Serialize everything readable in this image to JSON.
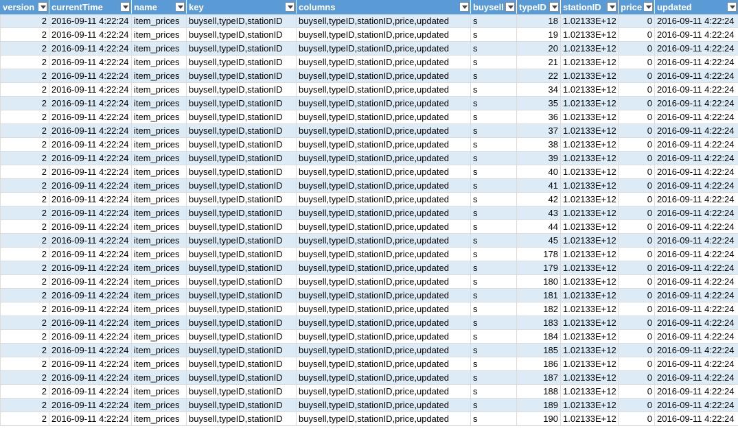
{
  "headers": [
    "version",
    "currentTime",
    "name",
    "key",
    "columns",
    "buysell",
    "typeID",
    "stationID",
    "price",
    "updated"
  ],
  "rows": [
    [
      "2",
      "2016-09-11 4:22:24",
      "item_prices",
      "buysell,typeID,stationID",
      "buysell,typeID,stationID,price,updated",
      "s",
      "18",
      "1.02133E+12",
      "0",
      "2016-09-11 4:22:24"
    ],
    [
      "2",
      "2016-09-11 4:22:24",
      "item_prices",
      "buysell,typeID,stationID",
      "buysell,typeID,stationID,price,updated",
      "s",
      "19",
      "1.02133E+12",
      "0",
      "2016-09-11 4:22:24"
    ],
    [
      "2",
      "2016-09-11 4:22:24",
      "item_prices",
      "buysell,typeID,stationID",
      "buysell,typeID,stationID,price,updated",
      "s",
      "20",
      "1.02133E+12",
      "0",
      "2016-09-11 4:22:24"
    ],
    [
      "2",
      "2016-09-11 4:22:24",
      "item_prices",
      "buysell,typeID,stationID",
      "buysell,typeID,stationID,price,updated",
      "s",
      "21",
      "1.02133E+12",
      "0",
      "2016-09-11 4:22:24"
    ],
    [
      "2",
      "2016-09-11 4:22:24",
      "item_prices",
      "buysell,typeID,stationID",
      "buysell,typeID,stationID,price,updated",
      "s",
      "22",
      "1.02133E+12",
      "0",
      "2016-09-11 4:22:24"
    ],
    [
      "2",
      "2016-09-11 4:22:24",
      "item_prices",
      "buysell,typeID,stationID",
      "buysell,typeID,stationID,price,updated",
      "s",
      "34",
      "1.02133E+12",
      "0",
      "2016-09-11 4:22:24"
    ],
    [
      "2",
      "2016-09-11 4:22:24",
      "item_prices",
      "buysell,typeID,stationID",
      "buysell,typeID,stationID,price,updated",
      "s",
      "35",
      "1.02133E+12",
      "0",
      "2016-09-11 4:22:24"
    ],
    [
      "2",
      "2016-09-11 4:22:24",
      "item_prices",
      "buysell,typeID,stationID",
      "buysell,typeID,stationID,price,updated",
      "s",
      "36",
      "1.02133E+12",
      "0",
      "2016-09-11 4:22:24"
    ],
    [
      "2",
      "2016-09-11 4:22:24",
      "item_prices",
      "buysell,typeID,stationID",
      "buysell,typeID,stationID,price,updated",
      "s",
      "37",
      "1.02133E+12",
      "0",
      "2016-09-11 4:22:24"
    ],
    [
      "2",
      "2016-09-11 4:22:24",
      "item_prices",
      "buysell,typeID,stationID",
      "buysell,typeID,stationID,price,updated",
      "s",
      "38",
      "1.02133E+12",
      "0",
      "2016-09-11 4:22:24"
    ],
    [
      "2",
      "2016-09-11 4:22:24",
      "item_prices",
      "buysell,typeID,stationID",
      "buysell,typeID,stationID,price,updated",
      "s",
      "39",
      "1.02133E+12",
      "0",
      "2016-09-11 4:22:24"
    ],
    [
      "2",
      "2016-09-11 4:22:24",
      "item_prices",
      "buysell,typeID,stationID",
      "buysell,typeID,stationID,price,updated",
      "s",
      "40",
      "1.02133E+12",
      "0",
      "2016-09-11 4:22:24"
    ],
    [
      "2",
      "2016-09-11 4:22:24",
      "item_prices",
      "buysell,typeID,stationID",
      "buysell,typeID,stationID,price,updated",
      "s",
      "41",
      "1.02133E+12",
      "0",
      "2016-09-11 4:22:24"
    ],
    [
      "2",
      "2016-09-11 4:22:24",
      "item_prices",
      "buysell,typeID,stationID",
      "buysell,typeID,stationID,price,updated",
      "s",
      "42",
      "1.02133E+12",
      "0",
      "2016-09-11 4:22:24"
    ],
    [
      "2",
      "2016-09-11 4:22:24",
      "item_prices",
      "buysell,typeID,stationID",
      "buysell,typeID,stationID,price,updated",
      "s",
      "43",
      "1.02133E+12",
      "0",
      "2016-09-11 4:22:24"
    ],
    [
      "2",
      "2016-09-11 4:22:24",
      "item_prices",
      "buysell,typeID,stationID",
      "buysell,typeID,stationID,price,updated",
      "s",
      "44",
      "1.02133E+12",
      "0",
      "2016-09-11 4:22:24"
    ],
    [
      "2",
      "2016-09-11 4:22:24",
      "item_prices",
      "buysell,typeID,stationID",
      "buysell,typeID,stationID,price,updated",
      "s",
      "45",
      "1.02133E+12",
      "0",
      "2016-09-11 4:22:24"
    ],
    [
      "2",
      "2016-09-11 4:22:24",
      "item_prices",
      "buysell,typeID,stationID",
      "buysell,typeID,stationID,price,updated",
      "s",
      "178",
      "1.02133E+12",
      "0",
      "2016-09-11 4:22:24"
    ],
    [
      "2",
      "2016-09-11 4:22:24",
      "item_prices",
      "buysell,typeID,stationID",
      "buysell,typeID,stationID,price,updated",
      "s",
      "179",
      "1.02133E+12",
      "0",
      "2016-09-11 4:22:24"
    ],
    [
      "2",
      "2016-09-11 4:22:24",
      "item_prices",
      "buysell,typeID,stationID",
      "buysell,typeID,stationID,price,updated",
      "s",
      "180",
      "1.02133E+12",
      "0",
      "2016-09-11 4:22:24"
    ],
    [
      "2",
      "2016-09-11 4:22:24",
      "item_prices",
      "buysell,typeID,stationID",
      "buysell,typeID,stationID,price,updated",
      "s",
      "181",
      "1.02133E+12",
      "0",
      "2016-09-11 4:22:24"
    ],
    [
      "2",
      "2016-09-11 4:22:24",
      "item_prices",
      "buysell,typeID,stationID",
      "buysell,typeID,stationID,price,updated",
      "s",
      "182",
      "1.02133E+12",
      "0",
      "2016-09-11 4:22:24"
    ],
    [
      "2",
      "2016-09-11 4:22:24",
      "item_prices",
      "buysell,typeID,stationID",
      "buysell,typeID,stationID,price,updated",
      "s",
      "183",
      "1.02133E+12",
      "0",
      "2016-09-11 4:22:24"
    ],
    [
      "2",
      "2016-09-11 4:22:24",
      "item_prices",
      "buysell,typeID,stationID",
      "buysell,typeID,stationID,price,updated",
      "s",
      "184",
      "1.02133E+12",
      "0",
      "2016-09-11 4:22:24"
    ],
    [
      "2",
      "2016-09-11 4:22:24",
      "item_prices",
      "buysell,typeID,stationID",
      "buysell,typeID,stationID,price,updated",
      "s",
      "185",
      "1.02133E+12",
      "0",
      "2016-09-11 4:22:24"
    ],
    [
      "2",
      "2016-09-11 4:22:24",
      "item_prices",
      "buysell,typeID,stationID",
      "buysell,typeID,stationID,price,updated",
      "s",
      "186",
      "1.02133E+12",
      "0",
      "2016-09-11 4:22:24"
    ],
    [
      "2",
      "2016-09-11 4:22:24",
      "item_prices",
      "buysell,typeID,stationID",
      "buysell,typeID,stationID,price,updated",
      "s",
      "187",
      "1.02133E+12",
      "0",
      "2016-09-11 4:22:24"
    ],
    [
      "2",
      "2016-09-11 4:22:24",
      "item_prices",
      "buysell,typeID,stationID",
      "buysell,typeID,stationID,price,updated",
      "s",
      "188",
      "1.02133E+12",
      "0",
      "2016-09-11 4:22:24"
    ],
    [
      "2",
      "2016-09-11 4:22:24",
      "item_prices",
      "buysell,typeID,stationID",
      "buysell,typeID,stationID,price,updated",
      "s",
      "189",
      "1.02133E+12",
      "0",
      "2016-09-11 4:22:24"
    ],
    [
      "2",
      "2016-09-11 4:22:24",
      "item_prices",
      "buysell,typeID,stationID",
      "buysell,typeID,stationID,price,updated",
      "s",
      "190",
      "1.02133E+12",
      "0",
      "2016-09-11 4:22:24"
    ]
  ],
  "colors": {
    "header": "#5b9bd5",
    "band": "#ddebf7"
  },
  "icons": {
    "filter": "filter-dropdown-icon"
  }
}
